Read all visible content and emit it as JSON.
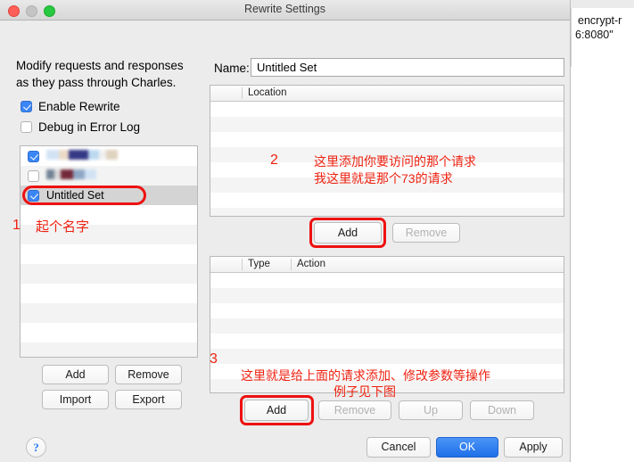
{
  "background": {
    "text_line_1": "encrypt-r",
    "text_line_2": "6:8080\""
  },
  "window": {
    "title": "Rewrite Settings",
    "traffic_lights": [
      "close-red",
      "minimize-gray",
      "zoom-green"
    ]
  },
  "left_panel": {
    "description_line_1": "Modify requests and responses",
    "description_line_2": "as they pass through Charles.",
    "checkboxes": [
      {
        "label": "Enable Rewrite",
        "checked": true
      },
      {
        "label": "Debug in Error Log",
        "checked": false
      }
    ],
    "set_list": [
      {
        "label": "",
        "checked": true,
        "redacted": true,
        "selected": false
      },
      {
        "label": "",
        "checked": false,
        "redacted": true,
        "selected": false
      },
      {
        "label": "Untitled Set",
        "checked": true,
        "redacted": false,
        "selected": true
      }
    ],
    "buttons": {
      "add": "Add",
      "remove": "Remove",
      "import": "Import",
      "export": "Export"
    },
    "help_button": "?"
  },
  "right_panel": {
    "name_label": "Name:",
    "name_value": "Untitled Set",
    "name_placeholder": "Untitled Set",
    "location_table": {
      "columns": [
        "Location"
      ],
      "rows": []
    },
    "location_buttons": {
      "add": "Add",
      "remove": "Remove",
      "remove_disabled": true
    },
    "action_table": {
      "columns": [
        "Type",
        "Action"
      ],
      "rows": []
    },
    "action_buttons": {
      "add": "Add",
      "remove": "Remove",
      "up": "Up",
      "down": "Down",
      "remove_disabled": true,
      "up_disabled": true,
      "down_disabled": true
    }
  },
  "dialog_buttons": {
    "cancel": "Cancel",
    "ok": "OK",
    "apply": "Apply",
    "default_button": "OK"
  },
  "annotations": {
    "color": "#ee2211",
    "step1_number": "1",
    "step1_text": "起个名字",
    "step2_number": "2",
    "step2_text_line1": "这里添加你要访问的那个请求",
    "step2_text_line2": "我这里就是那个73的请求",
    "step3_number": "3",
    "step3_text_line1": "这里就是给上面的请求添加、修改参数等操作",
    "step3_text_line2": "例子见下图"
  }
}
